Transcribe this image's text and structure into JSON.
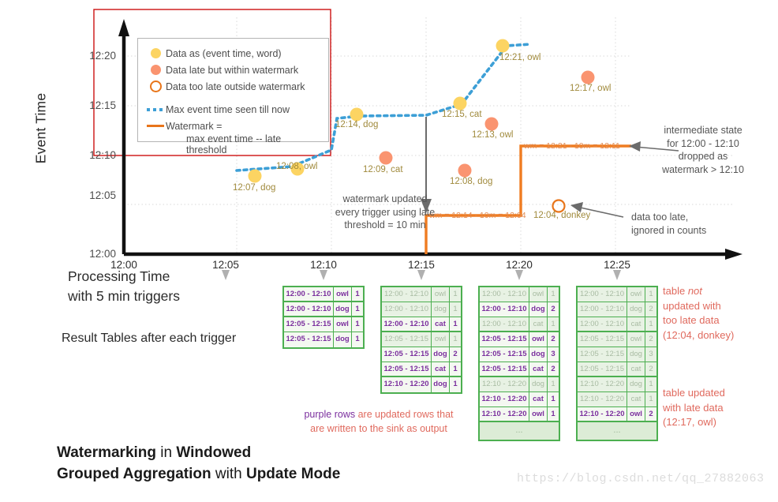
{
  "axes": {
    "y_title": "Event Time",
    "y_ticks": [
      "12:20",
      "12:15",
      "12:10",
      "12:05",
      "12:00"
    ],
    "x_ticks": [
      "12:00",
      "12:05",
      "12:10",
      "12:15",
      "12:20",
      "12:25"
    ],
    "x_title_line1": "Processing Time",
    "x_title_line2": "with 5 min triggers"
  },
  "legend": {
    "items": [
      {
        "key": "yellow-dot",
        "label": "Data as (event time, word)"
      },
      {
        "key": "salmon-dot",
        "label": "Data late but within watermark"
      },
      {
        "key": "hollow-dot",
        "label": "Data too late outside watermark"
      },
      {
        "key": "blue-dashed-line",
        "label": "Max event time seen till now"
      },
      {
        "key": "orange-line",
        "label": "Watermark ="
      }
    ],
    "sub_label": "max event time -- late threshold"
  },
  "points": [
    {
      "label": "12:07, dog",
      "kind": "yellow"
    },
    {
      "label": "12:08, owl",
      "kind": "yellow"
    },
    {
      "label": "12:14, dog",
      "kind": "yellow"
    },
    {
      "label": "12:15, cat",
      "kind": "yellow"
    },
    {
      "label": "12:21, owl",
      "kind": "yellow"
    },
    {
      "label": "12:09, cat",
      "kind": "salmon"
    },
    {
      "label": "12:08, dog",
      "kind": "salmon"
    },
    {
      "label": "12:13, owl",
      "kind": "salmon"
    },
    {
      "label": "12:17, owl",
      "kind": "salmon"
    },
    {
      "label": "12:04, donkey",
      "kind": "hollow"
    }
  ],
  "watermark_labels": {
    "first": "wm = 12:14 - 10m = 12:04",
    "second": "wm = 12:21 - 10m = 12:11"
  },
  "annotations": {
    "watermark_updated": "watermark updated\never y trigger using late\nthreshold = 10 min",
    "watermark_updated_l1": "watermark updated",
    "watermark_updated_l2": "every trigger using late",
    "watermark_updated_l3": "threshold = 10 min",
    "intermediate_l1": "intermediate state",
    "intermediate_l2": "for 12:00 - 12:10",
    "intermediate_l3": "dropped as",
    "intermediate_l4": "watermark > 12:10",
    "too_late_l1": "data too late,",
    "too_late_l2": "ignored in counts",
    "table_not_updated_l1": "table not",
    "table_not_updated_l2": "updated with",
    "table_not_updated_l3": "too late data",
    "table_not_updated_l4": "(12:04, donkey)",
    "table_updated_l1": "table updated",
    "table_updated_l2": "with late data",
    "table_updated_l3": "(12:17, owl)",
    "purple_note_strong": "purple rows",
    "purple_note_rest_l1": " are updated rows that",
    "purple_note_l2": "are written to the sink as output"
  },
  "labels": {
    "result_tables": "Result Tables after each trigger",
    "bottom_title_l1_a": "Watermarking",
    "bottom_title_l1_b": " in ",
    "bottom_title_l1_c": "Windowed",
    "bottom_title_l2_a": "Grouped Aggregation",
    "bottom_title_l2_b": " with ",
    "bottom_title_l2_c": "Update Mode",
    "url": "https://blog.csdn.net/qq_27882063"
  },
  "tables": [
    {
      "trigger": "12:10",
      "rows": [
        {
          "window": "12:00 - 12:10",
          "word": "owl",
          "count": "1",
          "state": "purple",
          "sep": true
        },
        {
          "window": "12:00 - 12:10",
          "word": "dog",
          "count": "1",
          "state": "purple",
          "sep": true
        },
        {
          "window": "12:05 - 12:15",
          "word": "owl",
          "count": "1",
          "state": "purple",
          "sep": false
        },
        {
          "window": "12:05 - 12:15",
          "word": "dog",
          "count": "1",
          "state": "purple",
          "sep": false
        }
      ]
    },
    {
      "trigger": "12:15",
      "rows": [
        {
          "window": "12:00 - 12:10",
          "word": "owl",
          "count": "1",
          "state": "gray",
          "sep": false
        },
        {
          "window": "12:00 - 12:10",
          "word": "dog",
          "count": "1",
          "state": "gray",
          "sep": false
        },
        {
          "window": "12:00 - 12:10",
          "word": "cat",
          "count": "1",
          "state": "purple",
          "sep": true
        },
        {
          "window": "12:05 - 12:15",
          "word": "owl",
          "count": "1",
          "state": "gray",
          "sep": false
        },
        {
          "window": "12:05 - 12:15",
          "word": "dog",
          "count": "2",
          "state": "purple",
          "sep": false
        },
        {
          "window": "12:05 - 12:15",
          "word": "cat",
          "count": "1",
          "state": "purple",
          "sep": true
        },
        {
          "window": "12:10 - 12:20",
          "word": "dog",
          "count": "1",
          "state": "purple",
          "sep": false
        }
      ]
    },
    {
      "trigger": "12:20",
      "rows": [
        {
          "window": "12:00 - 12:10",
          "word": "owl",
          "count": "1",
          "state": "gray",
          "sep": false
        },
        {
          "window": "12:00 - 12:10",
          "word": "dog",
          "count": "2",
          "state": "purple",
          "sep": false
        },
        {
          "window": "12:00 - 12:10",
          "word": "cat",
          "count": "1",
          "state": "gray",
          "sep": true
        },
        {
          "window": "12:05 - 12:15",
          "word": "owl",
          "count": "2",
          "state": "purple",
          "sep": false
        },
        {
          "window": "12:05 - 12:15",
          "word": "dog",
          "count": "3",
          "state": "purple",
          "sep": false
        },
        {
          "window": "12:05 - 12:15",
          "word": "cat",
          "count": "2",
          "state": "purple",
          "sep": true
        },
        {
          "window": "12:10 - 12:20",
          "word": "dog",
          "count": "1",
          "state": "gray",
          "sep": false
        },
        {
          "window": "12:10 - 12:20",
          "word": "cat",
          "count": "1",
          "state": "purple",
          "sep": false
        },
        {
          "window": "12:10 - 12:20",
          "word": "owl",
          "count": "1",
          "state": "purple",
          "sep": true
        },
        {
          "window": "...",
          "word": "",
          "count": "",
          "state": "ellipsis",
          "sep": false
        }
      ]
    },
    {
      "trigger": "12:25",
      "rows": [
        {
          "window": "12:00 - 12:10",
          "word": "owl",
          "count": "1",
          "state": "gray",
          "sep": false
        },
        {
          "window": "12:00 - 12:10",
          "word": "dog",
          "count": "2",
          "state": "gray",
          "sep": false
        },
        {
          "window": "12:00 - 12:10",
          "word": "cat",
          "count": "1",
          "state": "gray",
          "sep": true
        },
        {
          "window": "12:05 - 12:15",
          "word": "owl",
          "count": "2",
          "state": "gray",
          "sep": false
        },
        {
          "window": "12:05 - 12:15",
          "word": "dog",
          "count": "3",
          "state": "gray",
          "sep": false
        },
        {
          "window": "12:05 - 12:15",
          "word": "cat",
          "count": "2",
          "state": "gray",
          "sep": true
        },
        {
          "window": "12:10 - 12:20",
          "word": "dog",
          "count": "1",
          "state": "gray",
          "sep": false
        },
        {
          "window": "12:10 - 12:20",
          "word": "cat",
          "count": "1",
          "state": "gray",
          "sep": false
        },
        {
          "window": "12:10 - 12:20",
          "word": "owl",
          "count": "2",
          "state": "purple",
          "sep": true
        },
        {
          "window": "...",
          "word": "",
          "count": "",
          "state": "ellipsis",
          "sep": false
        }
      ]
    }
  ],
  "chart_data": {
    "type": "scatter",
    "title": "Watermarking in Windowed Grouped Aggregation with Update Mode",
    "xlabel": "Processing Time with 5 min triggers",
    "ylabel": "Event Time",
    "xlim": [
      "12:00",
      "12:26"
    ],
    "ylim": [
      "12:00",
      "12:22"
    ],
    "xticks": [
      "12:00",
      "12:05",
      "12:10",
      "12:15",
      "12:20",
      "12:25"
    ],
    "yticks": [
      "12:00",
      "12:05",
      "12:10",
      "12:15",
      "12:20"
    ],
    "grid": true,
    "legend_position": "upper-left",
    "series": [
      {
        "name": "Data as (event time, word)",
        "color": "#fcd462",
        "points": [
          {
            "processing_time": "12:06",
            "event_time": "12:07",
            "word": "dog"
          },
          {
            "processing_time": "12:09",
            "event_time": "12:08",
            "word": "owl"
          },
          {
            "processing_time": "12:12",
            "event_time": "12:14",
            "word": "dog"
          },
          {
            "processing_time": "12:17",
            "event_time": "12:15",
            "word": "cat"
          },
          {
            "processing_time": "12:19",
            "event_time": "12:21",
            "word": "owl"
          }
        ]
      },
      {
        "name": "Data late but within watermark",
        "color": "#fa9470",
        "points": [
          {
            "processing_time": "12:13",
            "event_time": "12:09",
            "word": "cat"
          },
          {
            "processing_time": "12:17",
            "event_time": "12:08",
            "word": "dog"
          },
          {
            "processing_time": "12:18",
            "event_time": "12:13",
            "word": "owl"
          },
          {
            "processing_time": "12:23",
            "event_time": "12:17",
            "word": "owl"
          }
        ]
      },
      {
        "name": "Data too late outside watermark",
        "color": "#e8751a",
        "points": [
          {
            "processing_time": "12:22",
            "event_time": "12:04",
            "word": "donkey"
          }
        ]
      },
      {
        "name": "Max event time seen till now",
        "color": "#3d9fd6",
        "style": "dashed",
        "points": [
          {
            "processing_time": "12:06",
            "event_time": "12:07"
          },
          {
            "processing_time": "12:09",
            "event_time": "12:08"
          },
          {
            "processing_time": "12:10",
            "event_time": "12:14"
          },
          {
            "processing_time": "12:17",
            "event_time": "12:15"
          },
          {
            "processing_time": "12:19",
            "event_time": "12:21"
          },
          {
            "processing_time": "12:20",
            "event_time": "12:21"
          }
        ]
      },
      {
        "name": "Watermark = max event time -- late threshold",
        "color": "#e8751a",
        "style": "step",
        "points": [
          {
            "processing_time": "12:15",
            "event_time": "12:00"
          },
          {
            "processing_time": "12:15",
            "event_time": "12:04"
          },
          {
            "processing_time": "12:20",
            "event_time": "12:04"
          },
          {
            "processing_time": "12:20",
            "event_time": "12:11"
          },
          {
            "processing_time": "12:26",
            "event_time": "12:11"
          }
        ]
      }
    ]
  }
}
